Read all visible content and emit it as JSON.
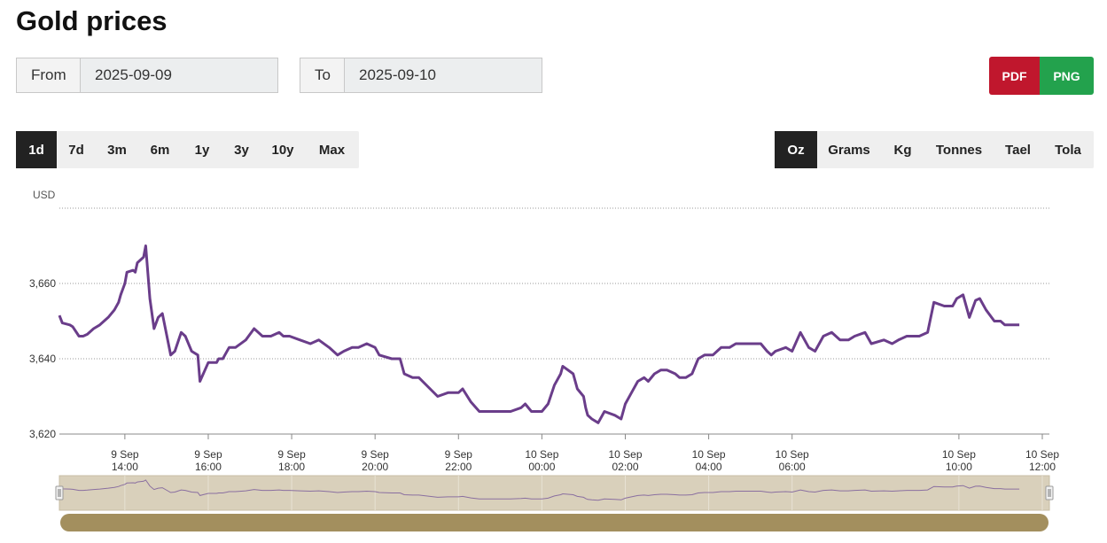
{
  "page": {
    "title": "Gold prices"
  },
  "date_range": {
    "from_label": "From",
    "from_value": "2025-09-09",
    "to_label": "To",
    "to_value": "2025-09-10"
  },
  "export": {
    "pdf_label": "PDF",
    "png_label": "PNG",
    "pdf_color": "#c0172d",
    "png_color": "#23a24d"
  },
  "range_tabs": {
    "items": [
      "1d",
      "7d",
      "3m",
      "6m",
      "1y",
      "3y",
      "10y",
      "Max"
    ],
    "active": "1d"
  },
  "unit_tabs": {
    "items": [
      "Oz",
      "Grams",
      "Kg",
      "Tonnes",
      "Tael",
      "Tola"
    ],
    "active": "Oz"
  },
  "chart_data": {
    "type": "line",
    "currency_label": "USD",
    "line_color": "#6a3d8a",
    "ylim": [
      3620,
      3680
    ],
    "yticks": [
      3620,
      3640,
      3660
    ],
    "ytick_labels": [
      "3,620",
      "3,640",
      "3,660"
    ],
    "grid": "horizontal dotted",
    "xlim_hours": [
      12.43,
      36.17
    ],
    "xticks": [
      {
        "h": 14,
        "date": "9 Sep",
        "time": "14:00"
      },
      {
        "h": 16,
        "date": "9 Sep",
        "time": "16:00"
      },
      {
        "h": 18,
        "date": "9 Sep",
        "time": "18:00"
      },
      {
        "h": 20,
        "date": "9 Sep",
        "time": "20:00"
      },
      {
        "h": 22,
        "date": "9 Sep",
        "time": "22:00"
      },
      {
        "h": 24,
        "date": "10 Sep",
        "time": "00:00"
      },
      {
        "h": 26,
        "date": "10 Sep",
        "time": "02:00"
      },
      {
        "h": 28,
        "date": "10 Sep",
        "time": "04:00"
      },
      {
        "h": 30,
        "date": "10 Sep",
        "time": "06:00"
      },
      {
        "h": 34,
        "date": "10 Sep",
        "time": "10:00"
      },
      {
        "h": 36,
        "date": "10 Sep",
        "time": "12:00"
      }
    ],
    "series": [
      {
        "x_hours": [
          12.43,
          12.5,
          12.68,
          12.75,
          12.9,
          13.0,
          13.1,
          13.25,
          13.4,
          13.6,
          13.75,
          13.85,
          13.9,
          14.0,
          14.05,
          14.2,
          14.25,
          14.3,
          14.45,
          14.5,
          14.6,
          14.7,
          14.8,
          14.9,
          15.1,
          15.2,
          15.35,
          15.45,
          15.6,
          15.75,
          15.8,
          16.0,
          16.2,
          16.25,
          16.35,
          16.5,
          16.65,
          16.9,
          17.1,
          17.3,
          17.5,
          17.7,
          17.8,
          17.95,
          18.2,
          18.45,
          18.65,
          18.9,
          19.1,
          19.25,
          19.45,
          19.6,
          19.8,
          20.0,
          20.1,
          20.4,
          20.6,
          20.7,
          20.9,
          21.05,
          21.5,
          21.75,
          22.0,
          22.1,
          22.3,
          22.5,
          22.7,
          22.85,
          23.0,
          23.25,
          23.5,
          23.6,
          23.75,
          24.0,
          24.15,
          24.3,
          24.45,
          24.5,
          24.75,
          24.85,
          25.0,
          25.05,
          25.1,
          25.2,
          25.35,
          25.5,
          25.75,
          25.9,
          26.0,
          26.15,
          26.3,
          26.45,
          26.55,
          26.7,
          26.85,
          27.0,
          27.2,
          27.3,
          27.45,
          27.6,
          27.75,
          27.9,
          28.1,
          28.2,
          28.3,
          28.5,
          28.65,
          28.9,
          29.1,
          29.25,
          29.4,
          29.5,
          29.6,
          29.85,
          30.0,
          30.2,
          30.4,
          30.55,
          30.75,
          30.95,
          31.15,
          31.35,
          31.5,
          31.75,
          31.9,
          32.2,
          32.4,
          32.55,
          32.75,
          32.9,
          33.05,
          33.25,
          33.4,
          33.65,
          33.85,
          33.95,
          34.1,
          34.25,
          34.4,
          34.5,
          34.65,
          34.85,
          35.0,
          35.1,
          35.25,
          35.45,
          35.6,
          35.8,
          35.95,
          36.17
        ],
        "y": [
          3651.5,
          3649.5,
          3649,
          3648.5,
          3646,
          3646,
          3646.5,
          3648,
          3649,
          3651,
          3653,
          3655,
          3657,
          3660,
          3663,
          3663.5,
          3663,
          3665.5,
          3667,
          3670,
          3656,
          3648,
          3651,
          3652,
          3641,
          3642,
          3647,
          3646,
          3642,
          3641,
          3634,
          3639,
          3639,
          3640,
          3640,
          3643,
          3643,
          3645,
          3648,
          3646,
          3646,
          3647,
          3646,
          3646,
          3645,
          3644,
          3645,
          3643,
          3641,
          3642,
          3643,
          3643,
          3644,
          3643,
          3641,
          3640,
          3640,
          3636,
          3635,
          3635,
          3630,
          3631,
          3631,
          3632,
          3628.5,
          3626,
          3626,
          3626,
          3626,
          3626,
          3627,
          3628,
          3626,
          3626,
          3628,
          3633,
          3636,
          3638,
          3636,
          3632,
          3630,
          3627,
          3625,
          3624,
          3623,
          3626,
          3625,
          3624,
          3628,
          3631,
          3634,
          3635,
          3634,
          3636,
          3637,
          3637,
          3636,
          3635,
          3635,
          3636,
          3640,
          3641,
          3641,
          3642,
          3643,
          3643,
          3644,
          3644,
          3644,
          3644,
          3642,
          3641,
          3642,
          3643,
          3642,
          3647,
          3643,
          3642,
          3646,
          3647,
          3645,
          3645,
          3646,
          3647,
          3644,
          3645,
          3644,
          3645,
          3646,
          3646,
          3646,
          3647,
          3655,
          3654,
          3654,
          3656,
          3657,
          3651,
          3655.5,
          3656,
          3653,
          3650,
          3650,
          3649,
          3649,
          3649
        ]
      }
    ]
  }
}
